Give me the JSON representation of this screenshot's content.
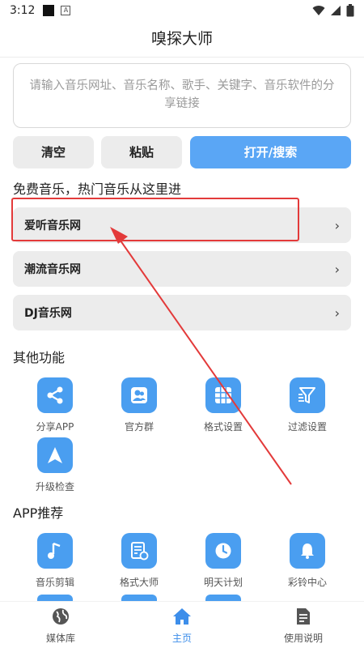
{
  "status_bar": {
    "time": "3:12",
    "a_badge": "A"
  },
  "header": {
    "title": "嗅探大师"
  },
  "search": {
    "placeholder": "请输入音乐网址、音乐名称、歌手、关键字、音乐软件的分享链接"
  },
  "buttons": {
    "clear": "清空",
    "paste": "粘贴",
    "open_search": "打开/搜索"
  },
  "free_music": {
    "title": "免费音乐，热门音乐从这里进",
    "items": [
      {
        "label": "爱听音乐网"
      },
      {
        "label": "潮流音乐网"
      },
      {
        "label": "DJ音乐网"
      }
    ],
    "chevron": "›"
  },
  "other_functions": {
    "title": "其他功能",
    "items": [
      {
        "label": "分享APP",
        "icon": "share-icon"
      },
      {
        "label": "官方群",
        "icon": "group-icon"
      },
      {
        "label": "格式设置",
        "icon": "grid-icon"
      },
      {
        "label": "过滤设置",
        "icon": "filter-icon"
      },
      {
        "label": "升级检查",
        "icon": "navigation-arrow-icon"
      }
    ]
  },
  "app_recommend": {
    "title": "APP推荐",
    "items": [
      {
        "label": "音乐剪辑",
        "icon": "music-note-icon"
      },
      {
        "label": "格式大师",
        "icon": "document-convert-icon"
      },
      {
        "label": "明天计划",
        "icon": "clock-icon"
      },
      {
        "label": "彩铃中心",
        "icon": "bell-icon"
      }
    ]
  },
  "bottom_nav": {
    "items": [
      {
        "label": "媒体库",
        "icon": "globe-icon",
        "active": false
      },
      {
        "label": "主页",
        "icon": "home-icon",
        "active": true
      },
      {
        "label": "使用说明",
        "icon": "manual-icon",
        "active": false
      }
    ]
  },
  "colors": {
    "accent": "#4a9ef0",
    "button_blue": "#5aa6f5",
    "highlight_red": "#e33a3a",
    "active_nav": "#3d8eea"
  }
}
